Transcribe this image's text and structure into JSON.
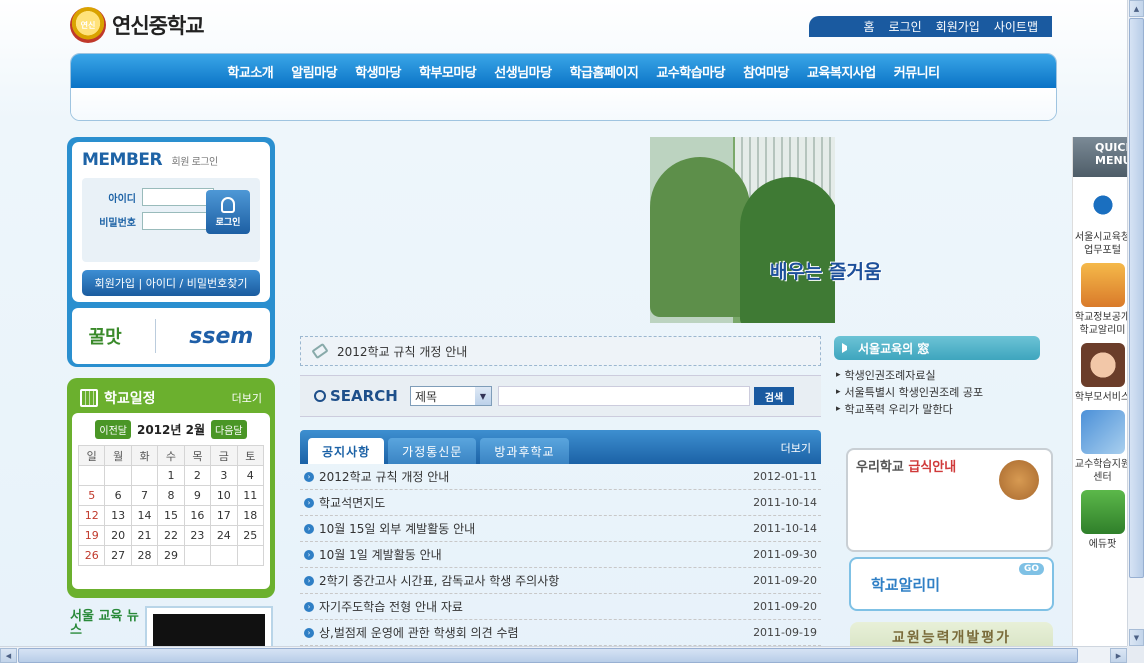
{
  "logo": {
    "name": "연신중학교",
    "emblem_text": "연신"
  },
  "util_nav": [
    "홈",
    "로그인",
    "회원가입",
    "사이트맵"
  ],
  "gnb": [
    "학교소개",
    "알림마당",
    "학생마당",
    "학부모마당",
    "선생님마당",
    "학급홈페이지",
    "교수학습마당",
    "참여마당",
    "교육복지사업",
    "커뮤니티"
  ],
  "member": {
    "title": "MEMBER",
    "subtitle": "회원 로그인",
    "id_label": "아이디",
    "pw_label": "비밀번호",
    "login_button": "로그인",
    "join_links": "회원가입 | 아이디 / 비밀번호찾기",
    "banner_left": "꿀맛",
    "banner_right": "ssem"
  },
  "schedule": {
    "title": "학교일정",
    "more": "더보기",
    "prev": "이전달",
    "next": "다음달",
    "year_month": "2012년 2월",
    "weekdays": [
      "일",
      "월",
      "화",
      "수",
      "목",
      "금",
      "토"
    ],
    "weeks": [
      [
        "",
        "",
        "",
        "1",
        "2",
        "3",
        "4"
      ],
      [
        "5",
        "6",
        "7",
        "8",
        "9",
        "10",
        "11"
      ],
      [
        "12",
        "13",
        "14",
        "15",
        "16",
        "17",
        "18"
      ],
      [
        "19",
        "20",
        "21",
        "22",
        "23",
        "24",
        "25"
      ],
      [
        "26",
        "27",
        "28",
        "29",
        "",
        "",
        ""
      ]
    ]
  },
  "left_bottom": {
    "seoul_news": "서울 교육 뉴스"
  },
  "visual": {
    "slogan": "배우는 즐거움"
  },
  "rule_bar": {
    "text": "2012학교 규칙 개정 안내"
  },
  "search": {
    "label": "SEARCH",
    "select_value": "제목",
    "button": "검색"
  },
  "board": {
    "tabs": [
      "공지사항",
      "가정통신문",
      "방과후학교"
    ],
    "more": "더보기",
    "items": [
      {
        "title": "2012학교 규칙 개정 안내",
        "date": "2012-01-11"
      },
      {
        "title": "학교석면지도",
        "date": "2011-10-14"
      },
      {
        "title": "10월 15일 외부 계발활동 안내",
        "date": "2011-10-14"
      },
      {
        "title": "10월 1일 계발활동 안내",
        "date": "2011-09-30"
      },
      {
        "title": "2학기 중간고사 시간표, 감독교사 학생 주의사항",
        "date": "2011-09-20"
      },
      {
        "title": "자기주도학습 전형 안내 자료",
        "date": "2011-09-20"
      },
      {
        "title": "상,벌점제 운영에 관한 학생회 의견 수렴",
        "date": "2011-09-19"
      }
    ]
  },
  "seoul_box": {
    "title": "서울교육의 窓",
    "links": [
      "학생인권조례자료실",
      "서울특별시 학생인권조례 공포",
      "학교폭력 우리가 말한다"
    ]
  },
  "meal": {
    "prefix": "우리학교",
    "highlight": "급식안내"
  },
  "alimi": {
    "label": "학교알리미",
    "badge": "GO"
  },
  "teacher_eval": {
    "label": "교원능력개발평가"
  },
  "quick_menu": {
    "header": "QUICK MENU",
    "items": [
      "서울시교육청 업무포털",
      "학교정보공개 학교알리미",
      "학부모서비스",
      "교수학습지원 센터",
      "에듀팟"
    ]
  }
}
